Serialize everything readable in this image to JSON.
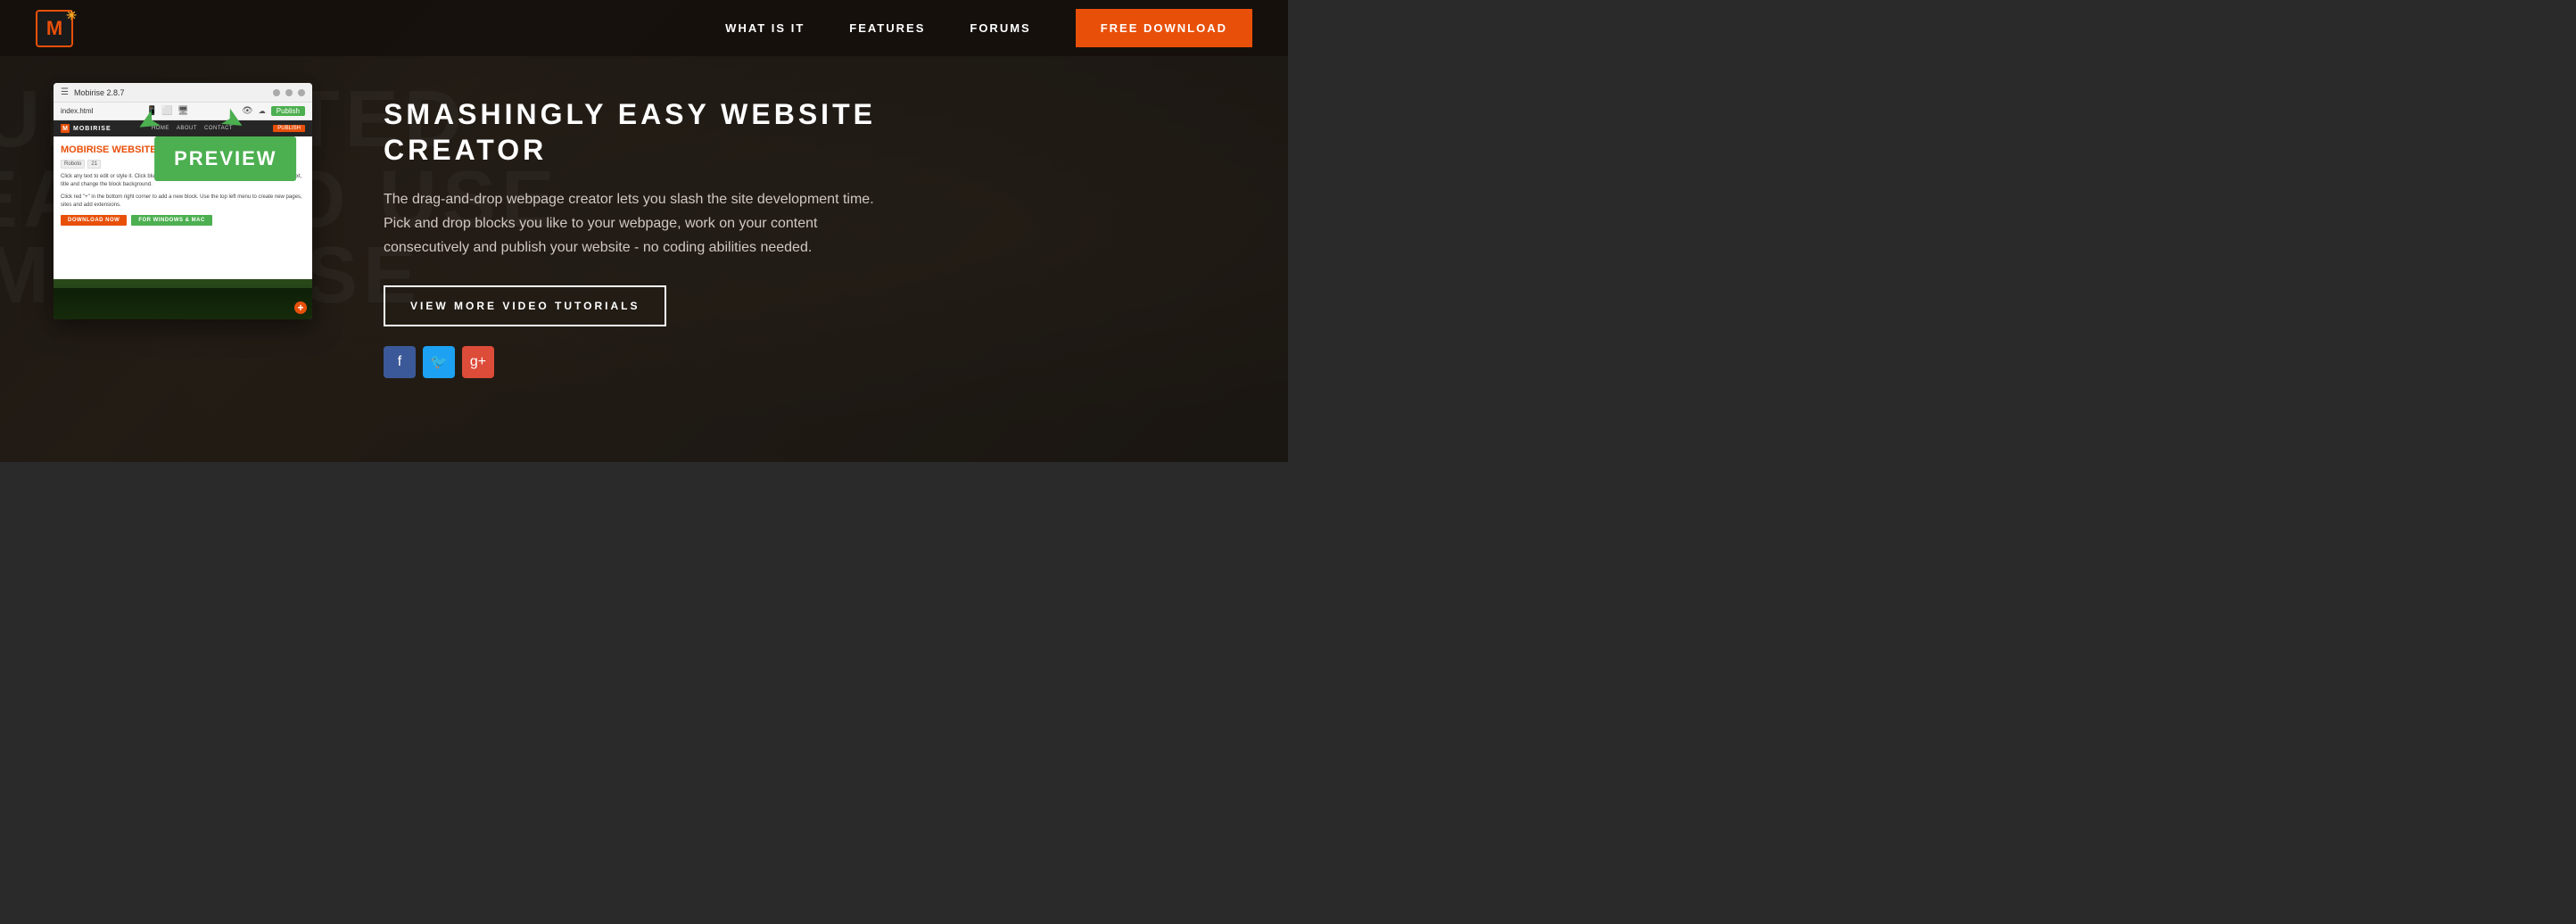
{
  "navbar": {
    "logo_letter": "M",
    "nav_links": [
      {
        "label": "WHAT IS IT",
        "id": "what-is-it"
      },
      {
        "label": "FEATURES",
        "id": "features"
      },
      {
        "label": "FORUMS",
        "id": "forums"
      }
    ],
    "download_label": "FREE DOWNLOAD"
  },
  "hero": {
    "heading_line1": "SMASHINGLY EASY WEBSITE",
    "heading_line2": "CREATOR",
    "description": "The drag-and-drop webpage creator lets you slash the site development time. Pick and drop blocks you like to your webpage, work on your content consecutively and publish your website - no coding abilities needed.",
    "video_btn_label": "VIEW MORE VIDEO TUTORIALS",
    "social": {
      "facebook": "f",
      "twitter": "t",
      "google": "g+"
    }
  },
  "app_window": {
    "title": "Mobirise 2.8.7",
    "file": "index.html",
    "publish_btn": "Publish",
    "inner": {
      "brand": "MOBIRISE",
      "mobile_view": "Mobile View",
      "nav_items": [
        "HOME",
        "ABOUT",
        "CONTACT"
      ],
      "heading": "MOBIRISE WEBSITE BUILD",
      "text1": "Click any text to edit or style it. Click blue \"Gear\" icon in the top right corner to hide/show buttons, text, title and change the block background.",
      "text2": "Click red \"+\" in the bottom right corner to add a new block. Use the top left menu to create new pages, sites and add extensions.",
      "btn1": "DOWNLOAD NOW",
      "btn2": "FOR WINDOWS & MAC"
    },
    "preview_label": "PREVIEW"
  },
  "background": {
    "text_lines": [
      "UNLIMITED",
      "EASY TO USE",
      "MOBIRISE"
    ]
  }
}
